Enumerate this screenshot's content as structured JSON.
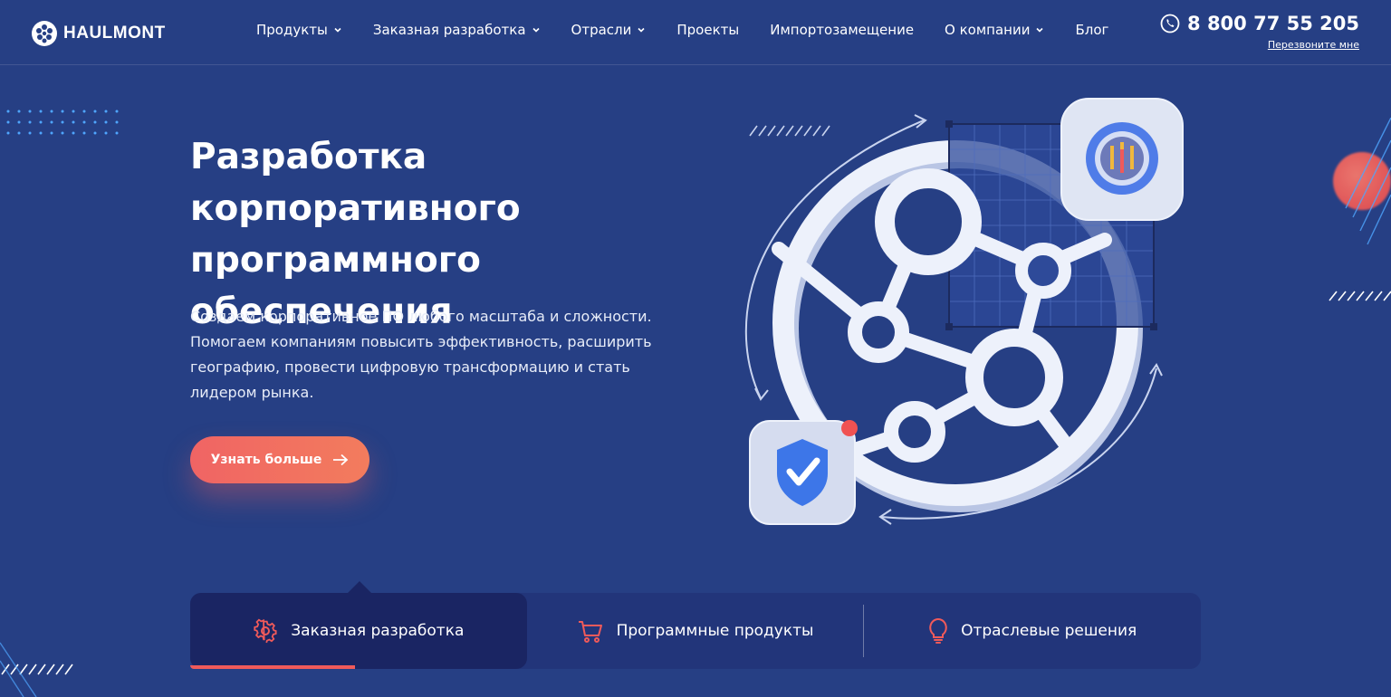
{
  "header": {
    "logo_text": "HAULMONT",
    "nav": [
      {
        "label": "Продукты",
        "has_dropdown": true
      },
      {
        "label": "Заказная разработка",
        "has_dropdown": true
      },
      {
        "label": "Отрасли",
        "has_dropdown": true
      },
      {
        "label": "Проекты",
        "has_dropdown": false
      },
      {
        "label": "Импортозамещение",
        "has_dropdown": false
      },
      {
        "label": "О компании",
        "has_dropdown": true
      },
      {
        "label": "Блог",
        "has_dropdown": false
      }
    ],
    "phone": "8 800 77 55 205",
    "callback_label": "Перезвоните мне"
  },
  "hero": {
    "title_line1": "Разработка",
    "title_line2": "корпоративного",
    "title_line3": "программного обеспечения",
    "desc_line1": "Создаем корпоративное ПО любого масштаба и сложности.",
    "desc_line2": "Помогаем компаниям повысить эффективность, расширить",
    "desc_line3": "географию, провести цифровую трансформацию и стать",
    "desc_line4": "лидером рынка.",
    "cta_label": "Узнать больше"
  },
  "tabs": [
    {
      "label": "Заказная разработка",
      "icon": "gear-icon",
      "active": true
    },
    {
      "label": "Программные продукты",
      "icon": "cart-icon",
      "active": false
    },
    {
      "label": "Отраслевые решения",
      "icon": "lightbulb-icon",
      "active": false
    }
  ],
  "colors": {
    "background": "#263f84",
    "accent": "#f05a5a",
    "tab_bar": "#22357a",
    "tab_active": "#1a2563"
  }
}
